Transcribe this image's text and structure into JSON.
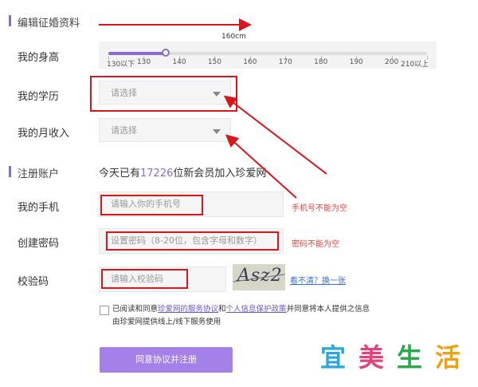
{
  "sections": {
    "profile_title": "编辑征婚资料",
    "account_title": "注册账户"
  },
  "height": {
    "label": "我的身高",
    "current": "160cm",
    "ticks": [
      "130以下",
      "130",
      "140",
      "150",
      "160",
      "170",
      "180",
      "190",
      "200",
      "210以上"
    ],
    "value_fraction": 0.18
  },
  "education": {
    "label": "我的学历",
    "placeholder": "请选择"
  },
  "income": {
    "label": "我的月收入",
    "placeholder": "请选择"
  },
  "account": {
    "today_prefix": "今天已有",
    "today_count": "17226",
    "today_suffix": "位新会员加入珍爱网"
  },
  "phone": {
    "label": "我的手机",
    "placeholder": "请输入你的手机号",
    "error": "手机号不能为空"
  },
  "password": {
    "label": "创建密码",
    "placeholder": "设置密码（8-20位，包含字母和数字）",
    "error": "密码不能为空"
  },
  "captcha": {
    "label": "校验码",
    "placeholder": "请输入校验码",
    "image_text": "Asz2",
    "refresh_link": "看不清？换一张"
  },
  "agreement": {
    "pre": "已阅读和同意",
    "link1": "珍爱网的服务协议",
    "mid": "和",
    "link2": "个人信息保护政策",
    "post": "并同意将本人提供之信息",
    "line2": "由珍爱网提供线上/线下服务使用"
  },
  "submit_label": "同意协议并注册",
  "watermark": {
    "chars": [
      "宜",
      "美",
      "生",
      "活"
    ],
    "colors": [
      "#29a8e0",
      "#e3427a",
      "#2aa84a",
      "#f2a10f"
    ]
  },
  "colors": {
    "accent": "#a481e8",
    "error": "#e0443c",
    "annotation_red": "#d9161c"
  }
}
